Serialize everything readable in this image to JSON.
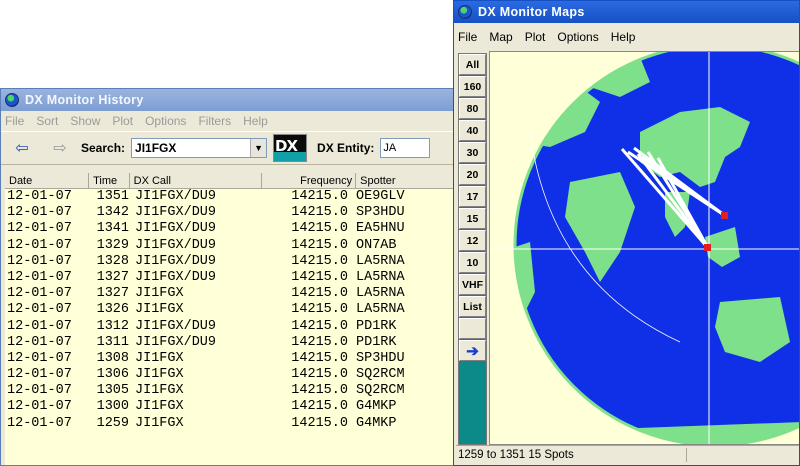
{
  "history": {
    "title": "DX Monitor History",
    "menu": [
      "File",
      "Sort",
      "Show",
      "Plot",
      "Options",
      "Filters",
      "Help"
    ],
    "toolbar": {
      "back_icon": "arrow-left-icon",
      "forward_icon": "arrow-right-icon",
      "search_label": "Search:",
      "search_value": "JI1FGX",
      "logo_text": "DX",
      "entity_label": "DX Entity:",
      "entity_value": "JA"
    },
    "columns": [
      "Date",
      "Time",
      "DX Call",
      "Frequency",
      "Spotter"
    ],
    "rows": [
      [
        "12-01-07",
        "1351",
        "JI1FGX/DU9",
        "14215.0",
        "OE9GLV"
      ],
      [
        "12-01-07",
        "1342",
        "JI1FGX/DU9",
        "14215.0",
        "SP3HDU"
      ],
      [
        "12-01-07",
        "1341",
        "JI1FGX/DU9",
        "14215.0",
        "EA5HNU"
      ],
      [
        "12-01-07",
        "1329",
        "JI1FGX/DU9",
        "14215.0",
        "ON7AB"
      ],
      [
        "12-01-07",
        "1328",
        "JI1FGX/DU9",
        "14215.0",
        "LA5RNA"
      ],
      [
        "12-01-07",
        "1327",
        "JI1FGX/DU9",
        "14215.0",
        "LA5RNA"
      ],
      [
        "12-01-07",
        "1327",
        "JI1FGX",
        "14215.0",
        "LA5RNA"
      ],
      [
        "12-01-07",
        "1326",
        "JI1FGX",
        "14215.0",
        "LA5RNA"
      ],
      [
        "12-01-07",
        "1312",
        "JI1FGX/DU9",
        "14215.0",
        "PD1RK"
      ],
      [
        "12-01-07",
        "1311",
        "JI1FGX/DU9",
        "14215.0",
        "PD1RK"
      ],
      [
        "12-01-07",
        "1308",
        "JI1FGX",
        "14215.0",
        "SP3HDU"
      ],
      [
        "12-01-07",
        "1306",
        "JI1FGX",
        "14215.0",
        "SQ2RCM"
      ],
      [
        "12-01-07",
        "1305",
        "JI1FGX",
        "14215.0",
        "SQ2RCM"
      ],
      [
        "12-01-07",
        "1300",
        "JI1FGX",
        "14215.0",
        "G4MKP"
      ],
      [
        "12-01-07",
        "1259",
        "JI1FGX",
        "14215.0",
        "G4MKP"
      ]
    ]
  },
  "maps": {
    "title": "DX Monitor Maps",
    "menu": [
      "File",
      "Map",
      "Plot",
      "Options",
      "Help"
    ],
    "bands": [
      "All",
      "160",
      "80",
      "40",
      "30",
      "20",
      "17",
      "15",
      "12",
      "10",
      "VHF",
      "List"
    ],
    "go_icon": "arrow-right-icon",
    "status": "1259 to 1351 15 Spots",
    "colors": {
      "ocean": "#1030e8",
      "land": "#7ee08a",
      "spot": "#e02020",
      "path": "#ffffff"
    }
  }
}
